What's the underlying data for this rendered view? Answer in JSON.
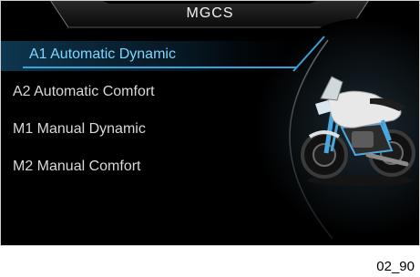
{
  "header": {
    "title": "MGCS"
  },
  "menu": {
    "items": [
      {
        "label": "A1 Automatic Dynamic",
        "selected": true
      },
      {
        "label": "A2 Automatic Comfort",
        "selected": false
      },
      {
        "label": "M1 Manual Dynamic",
        "selected": false
      },
      {
        "label": "M2 Manual Comfort",
        "selected": false
      }
    ]
  },
  "image": {
    "icon": "motorcycle-icon"
  },
  "footer": {
    "figure_code": "02_90"
  },
  "colors": {
    "selected": "#7fd6ff",
    "background": "#000000",
    "text": "#d9d9d9",
    "accent": "#3aa0d8"
  }
}
